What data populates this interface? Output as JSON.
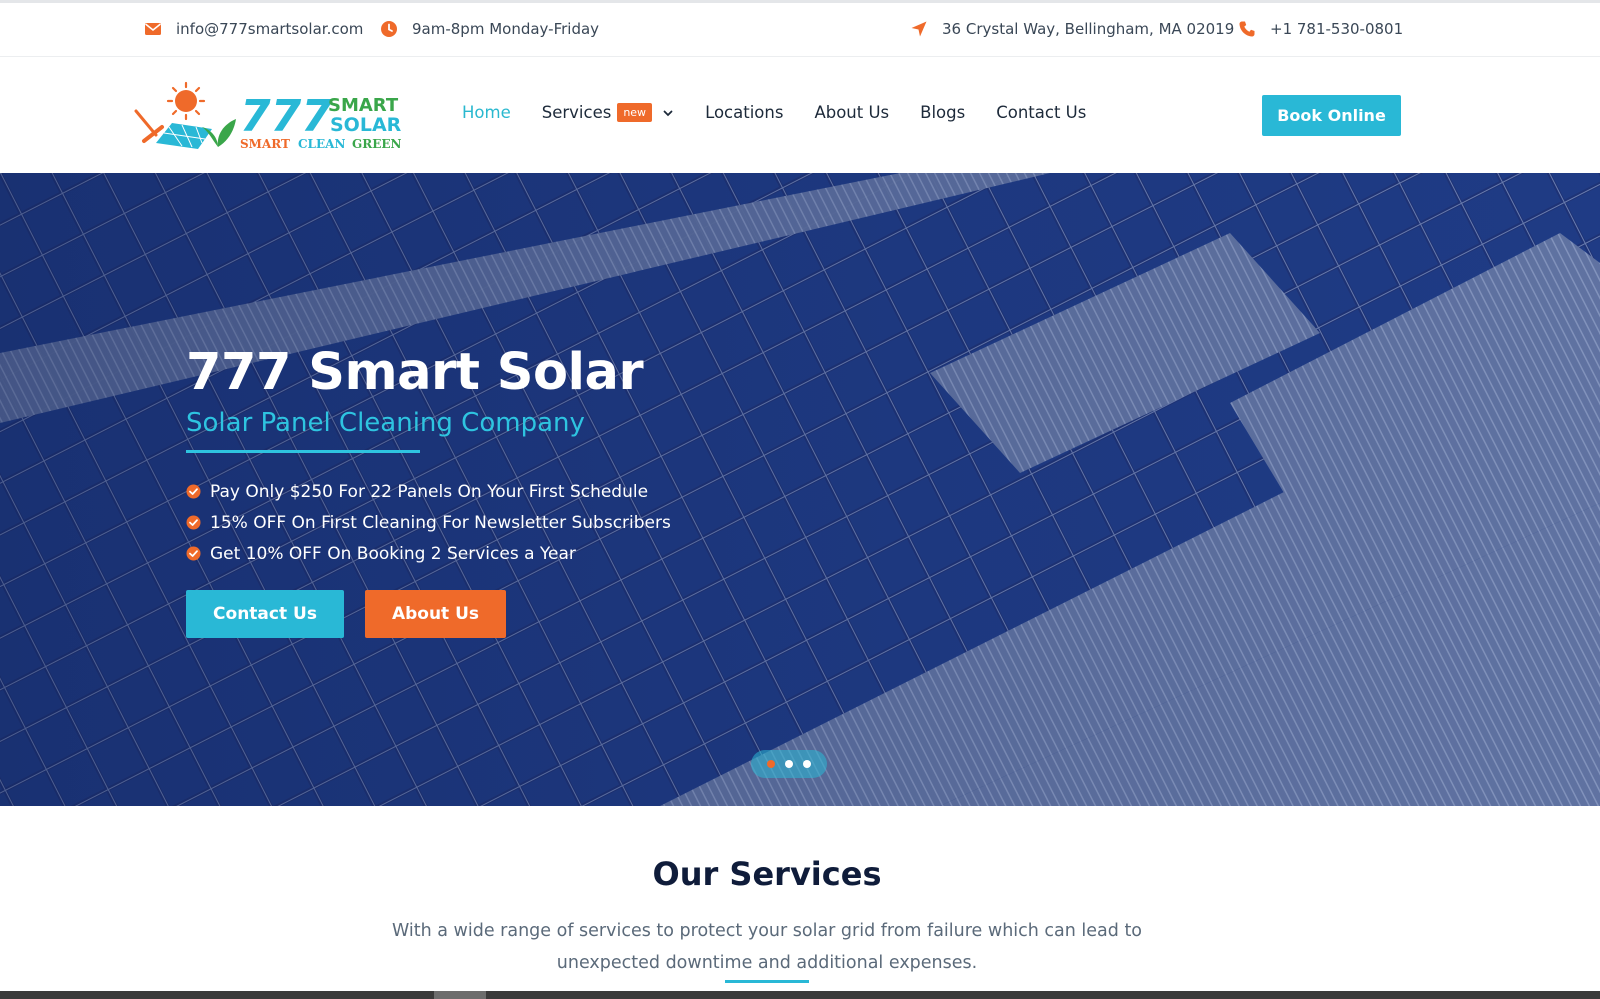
{
  "topbar": {
    "email": "info@777smartsolar.com",
    "hours": "9am-8pm Monday-Friday",
    "address": "36 Crystal Way, Bellingham, MA 02019",
    "phone": "+1 781-530-0801"
  },
  "logo": {
    "digits": "777",
    "word1": "SMART",
    "word2": "SOLAR",
    "tagline_smart": "SMART",
    "tagline_clean": "CLEAN",
    "tagline_green": "GREEN"
  },
  "nav": {
    "items": [
      {
        "label": "Home",
        "active": true
      },
      {
        "label": "Services",
        "badge": "new",
        "has_dropdown": true
      },
      {
        "label": "Locations"
      },
      {
        "label": "About Us"
      },
      {
        "label": "Blogs"
      },
      {
        "label": "Contact Us"
      }
    ],
    "book_button": "Book Online"
  },
  "hero": {
    "title": "777 Smart Solar",
    "subtitle": "Solar Panel Cleaning Company",
    "bullets": [
      "Pay Only $250 For 22 Panels On Your First Schedule",
      "15% OFF On First Cleaning For Newsletter Subscribers",
      "Get 10% OFF On Booking 2 Services a Year"
    ],
    "contact_button": "Contact Us",
    "about_button": "About Us",
    "slides": 3,
    "active_slide": 1
  },
  "services": {
    "title": "Our Services",
    "description": "With a wide range of services to protect your solar grid from failure which can lead to unexpected downtime and additional expenses."
  },
  "colors": {
    "accent_teal": "#29b8d6",
    "accent_orange": "#ef6a2a",
    "heading_dark": "#0f1c3a"
  },
  "icons": {
    "email": "envelope-icon",
    "hours": "clock-icon",
    "address": "location-arrow-icon",
    "phone": "phone-icon",
    "bullet": "check-circle-icon",
    "dropdown": "chevron-down-icon"
  }
}
